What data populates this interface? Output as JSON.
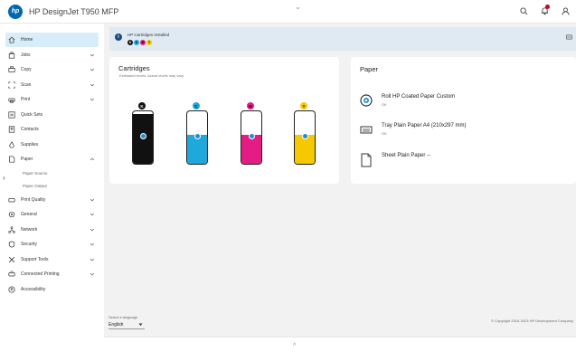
{
  "app": {
    "title": "HP DesignJet T950 MFP",
    "logo_text": "hp"
  },
  "top_handle": "⌄",
  "sidebar": {
    "items": [
      {
        "label": "Home",
        "icon": "home-icon",
        "expandable": false,
        "active": true
      },
      {
        "label": "Jobs",
        "icon": "jobs-icon",
        "expandable": true
      },
      {
        "label": "Copy",
        "icon": "copy-icon",
        "expandable": true
      },
      {
        "label": "Scan",
        "icon": "scan-icon",
        "expandable": true
      },
      {
        "label": "Print",
        "icon": "print-icon",
        "expandable": true
      },
      {
        "label": "Quick Sets",
        "icon": "quick-sets-icon",
        "expandable": false
      },
      {
        "label": "Contacts",
        "icon": "contacts-icon",
        "expandable": false
      },
      {
        "label": "Supplies",
        "icon": "supplies-icon",
        "expandable": false
      },
      {
        "label": "Paper",
        "icon": "paper-icon",
        "expandable": true,
        "expanded": true
      },
      {
        "label": "Print Quality",
        "icon": "print-quality-icon",
        "expandable": true
      },
      {
        "label": "General",
        "icon": "general-icon",
        "expandable": true
      },
      {
        "label": "Network",
        "icon": "network-icon",
        "expandable": true
      },
      {
        "label": "Security",
        "icon": "security-icon",
        "expandable": true
      },
      {
        "label": "Support Tools",
        "icon": "support-tools-icon",
        "expandable": true
      },
      {
        "label": "Connected Printing",
        "icon": "connected-printing-icon",
        "expandable": true
      },
      {
        "label": "Accessibility",
        "icon": "accessibility-icon",
        "expandable": false
      }
    ],
    "paper_subitems": [
      "Paper Source",
      "Paper Output"
    ],
    "language_label": "Select a language",
    "language_value": "English"
  },
  "banner": {
    "info": "i",
    "text": "HP Cartridges Installed",
    "dots": [
      "K",
      "C",
      "M",
      "Y"
    ]
  },
  "cartridges": {
    "title": "Cartridges",
    "subtitle": "Estimated levels. Actual levels may vary.",
    "items": [
      {
        "name": "Black",
        "badge": "K",
        "color": "#111111",
        "badge_bg": "#111111",
        "badge_fg": "#ffffff",
        "level": 0.95
      },
      {
        "name": "Cyan",
        "badge": "C",
        "color": "#1fa8dc",
        "badge_bg": "#1fa8dc",
        "badge_fg": "#000000",
        "level": 0.55
      },
      {
        "name": "Magenta",
        "badge": "M",
        "color": "#e41c84",
        "badge_bg": "#e41c84",
        "badge_fg": "#000000",
        "level": 0.55
      },
      {
        "name": "Yellow",
        "badge": "Y",
        "color": "#f5c800",
        "badge_bg": "#f5c800",
        "badge_fg": "#000000",
        "level": 0.55
      }
    ]
  },
  "paper": {
    "title": "Paper",
    "items": [
      {
        "name": "Roll HP Coated Paper Custom",
        "state": "OK",
        "icon": "roll-icon"
      },
      {
        "name": "Tray Plain Paper A4 (210x297 mm)",
        "state": "OK",
        "icon": "tray-icon"
      },
      {
        "name": "Sheet Plain Paper --",
        "state": "",
        "icon": "sheet-icon"
      }
    ]
  },
  "copyright": "© Copyright 2015-2023 HP Development Company",
  "bottom_handle": "^",
  "colors": {
    "accent": "#0067b1",
    "active_nav": "#d7edf8",
    "banner": "#dfeaf2"
  }
}
